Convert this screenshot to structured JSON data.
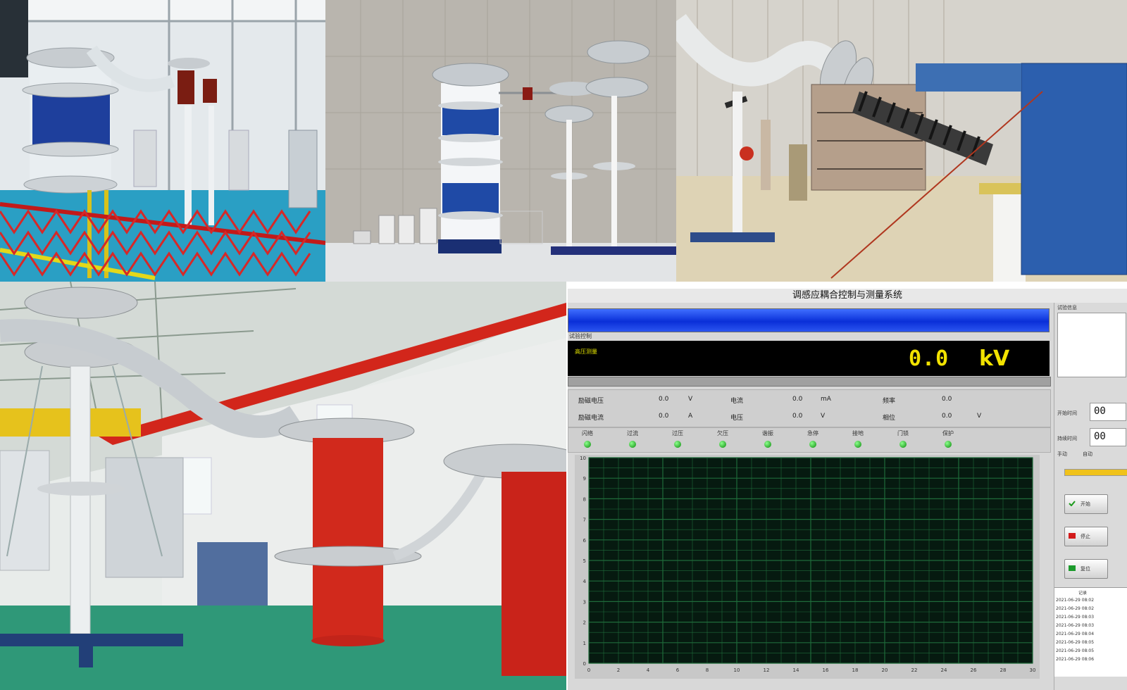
{
  "app": {
    "title": "调感应耦合控制与测量系统",
    "display": {
      "value": "0.0",
      "unit": "kV",
      "tag": "高压测量"
    },
    "section_label": "试验控制",
    "measurements": [
      {
        "label": "励磁电压",
        "value": "0.0",
        "unit": "V"
      },
      {
        "label": "电流",
        "value": "0.0",
        "unit": "mA"
      },
      {
        "label": "频率",
        "value": "0.0",
        "unit": ""
      },
      {
        "label": "励磁电流",
        "value": "0.0",
        "unit": "A"
      },
      {
        "label": "电压",
        "value": "0.0",
        "unit": "V"
      },
      {
        "label": "相位",
        "value": "0.0",
        "unit": "V"
      }
    ],
    "indicators": [
      "闪络",
      "过流",
      "过压",
      "欠压",
      "谐振",
      "急停",
      "接地",
      "门锁",
      "保护"
    ],
    "right_panel": {
      "header": "试验信息",
      "time_label_1": "开始时间",
      "time_value_1": "00",
      "time_label_2": "持续时间",
      "time_value_2": "00",
      "tabs": [
        "手动",
        "自动"
      ],
      "buttons": [
        {
          "label": "开始",
          "icon": "check-icon"
        },
        {
          "label": "停止",
          "icon": "stop-icon"
        },
        {
          "label": "复位",
          "icon": "reset-icon"
        }
      ],
      "log_header": "记录",
      "log_rows": [
        "2021-06-29 08:02",
        "2021-06-29 08:02",
        "2021-06-29 08:03",
        "2021-06-29 08:03",
        "2021-06-29 08:04",
        "2021-06-29 08:05",
        "2021-06-29 08:05",
        "2021-06-29 08:06"
      ]
    }
  },
  "chart_data": {
    "type": "line",
    "title": "",
    "xlabel": "",
    "ylabel": "",
    "xlim": [
      0,
      30
    ],
    "ylim": [
      0,
      10
    ],
    "grid": true,
    "series": [],
    "colors": {
      "background": "#061a10",
      "grid": "#1f6b3a"
    }
  }
}
